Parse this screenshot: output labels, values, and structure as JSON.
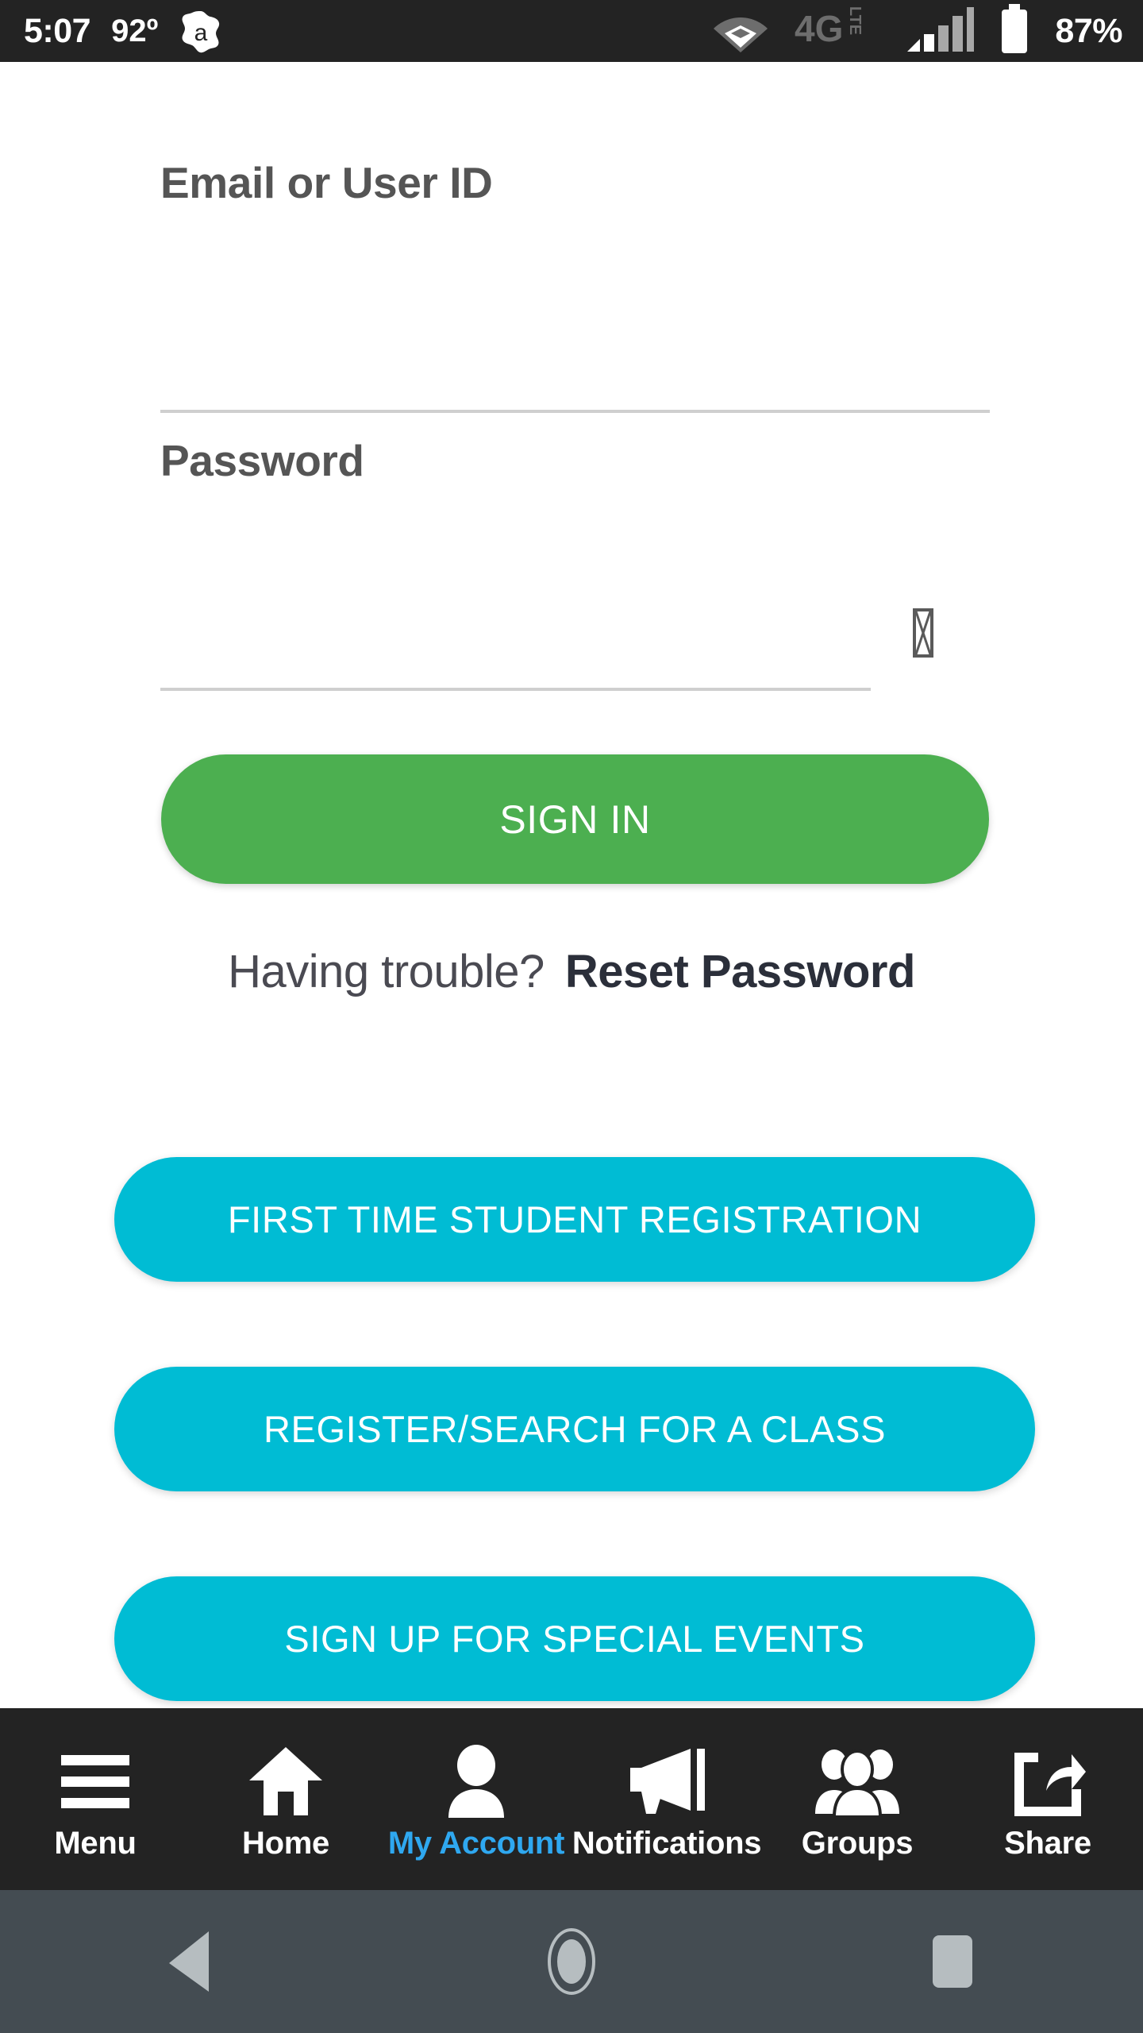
{
  "status_bar": {
    "clock": "5:07",
    "temperature": "92º",
    "app_icon": "avast-icon",
    "wifi_icon": "wifi-icon",
    "network_label": "4G",
    "network_sublabel": "LTE",
    "signal_icon": "cellular-signal-icon",
    "battery_icon": "battery-icon",
    "battery_percent": "87%",
    "background": "#232323"
  },
  "form": {
    "email": {
      "label": "Email or User ID",
      "value": "",
      "placeholder": ""
    },
    "password": {
      "label": "Password",
      "value": "",
      "placeholder": "",
      "visibility_toggle_icon": "missing-glyph-box"
    }
  },
  "primary_action": {
    "sign_in_label": "SIGN IN",
    "color": "#4caf50"
  },
  "help": {
    "trouble_text": "Having trouble?",
    "reset_link": "Reset Password"
  },
  "secondary_actions": {
    "color": "#00bcd4",
    "buttons": [
      {
        "label": "FIRST TIME STUDENT REGISTRATION"
      },
      {
        "label": "REGISTER/SEARCH FOR A CLASS"
      },
      {
        "label": "SIGN UP FOR SPECIAL EVENTS"
      }
    ]
  },
  "bottom_nav": {
    "background": "#232323",
    "active_color": "#2fa8f0",
    "items": [
      {
        "label": "Menu",
        "icon": "hamburger-icon"
      },
      {
        "label": "Home",
        "icon": "home-icon"
      },
      {
        "label": "My Account",
        "icon": "person-icon"
      },
      {
        "label": "Notifications",
        "icon": "megaphone-icon"
      },
      {
        "label": "Groups",
        "icon": "people-group-icon"
      },
      {
        "label": "Share",
        "icon": "share-icon"
      }
    ]
  },
  "system_nav": {
    "background": "#444c52",
    "back_icon": "back-triangle-icon",
    "home_icon": "home-circle-icon",
    "recents_icon": "recents-square-icon"
  }
}
